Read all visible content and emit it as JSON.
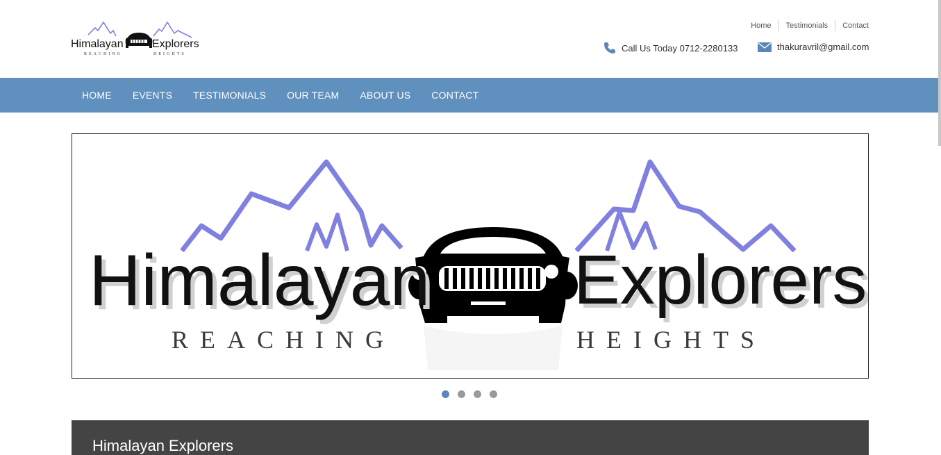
{
  "brand": {
    "logo_word_left": "Himalayan",
    "logo_word_right": "Explorers",
    "tagline_left": "REACHING",
    "tagline_right": "HEIGHTS",
    "mountain_color": "#8080e0"
  },
  "top_links": [
    "Home",
    "Testimonials",
    "Contact"
  ],
  "contact": {
    "phone_text": "Call Us Today 0712-2280133",
    "email": "thakuravril@gmail.com",
    "icon_color": "#5b87b8"
  },
  "nav": {
    "items": [
      "HOME",
      "EVENTS",
      "TESTIMONIALS",
      "OUR TEAM",
      "ABOUT US",
      "CONTACT"
    ],
    "bg_color": "#6090bd"
  },
  "slider": {
    "slide_count": 4,
    "active_slide": 1
  },
  "panel": {
    "title": "Himalayan Explorers",
    "bg_color": "#444444"
  }
}
